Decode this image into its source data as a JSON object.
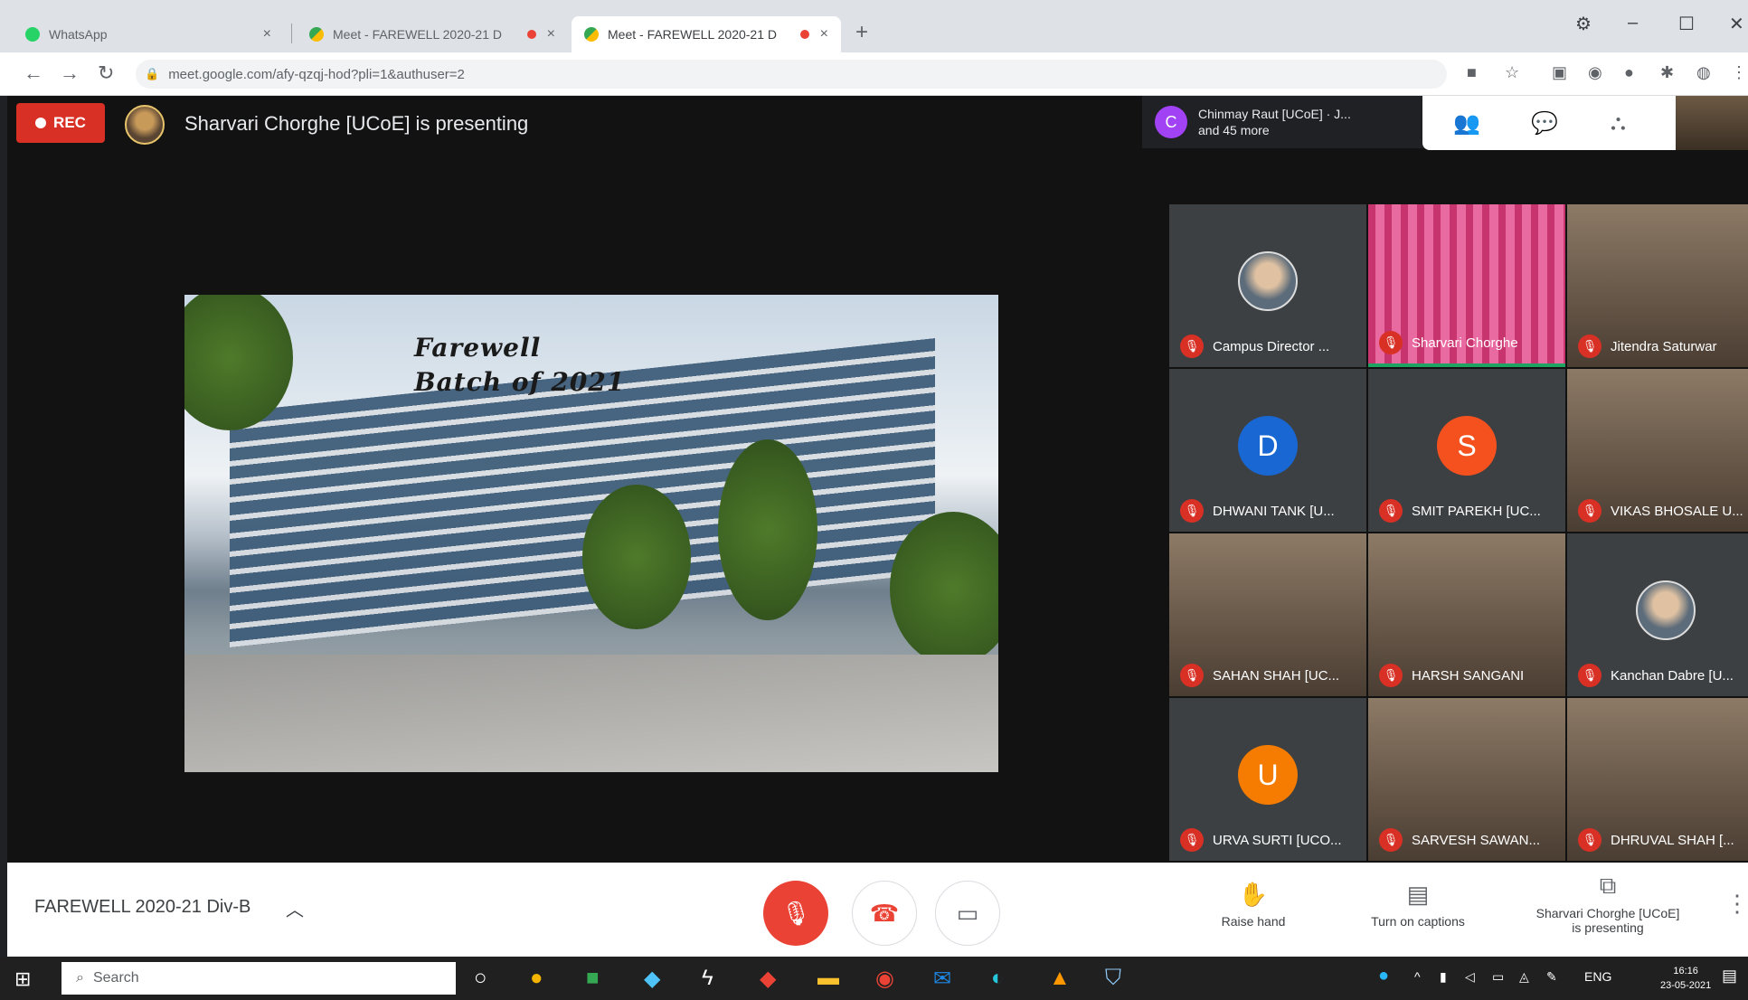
{
  "browser": {
    "tabs": [
      {
        "title": "WhatsApp",
        "color": "#25d366"
      },
      {
        "title": "Meet - FAREWELL 2020-21 D",
        "color": "#00897b"
      },
      {
        "title": "Meet - FAREWELL 2020-21 D",
        "color": "#00897b"
      }
    ],
    "close_glyph": "×",
    "new_tab_glyph": "+",
    "url": "meet.google.com/afy-qzqj-hod?pli=1&authuser=2"
  },
  "meet": {
    "rec_label": "REC",
    "presenting_text": "Sharvari Chorghe [UCoE] is presenting",
    "others": {
      "avatar_letter": "C",
      "line1": "Chinmay Raut [UCoE] · J...",
      "line2": "and 45 more"
    },
    "slide": {
      "line1": "Farewell",
      "line2": "Batch of 2021"
    },
    "participants": [
      {
        "name": "Campus Director ...",
        "type": "photo"
      },
      {
        "name": "Sharvari Chorghe",
        "type": "video-pink",
        "speaking": true
      },
      {
        "name": "Jitendra Saturwar",
        "type": "video"
      },
      {
        "name": "DHWANI TANK [U...",
        "type": "letter",
        "letter": "D",
        "color": "#1967d2"
      },
      {
        "name": "SMIT PAREKH [UC...",
        "type": "letter",
        "letter": "S",
        "color": "#f4511e"
      },
      {
        "name": "VIKAS BHOSALE U...",
        "type": "video"
      },
      {
        "name": "SAHAN SHAH [UC...",
        "type": "video"
      },
      {
        "name": "HARSH SANGANI",
        "type": "video"
      },
      {
        "name": "Kanchan Dabre [U...",
        "type": "photo"
      },
      {
        "name": "URVA SURTI [UCO...",
        "type": "letter",
        "letter": "U",
        "color": "#f57c00"
      },
      {
        "name": "SARVESH SAWAN...",
        "type": "video"
      },
      {
        "name": "DHRUVAL SHAH [...",
        "type": "video"
      }
    ]
  },
  "bottom": {
    "meeting_name": "FAREWELL 2020-21 Div-B",
    "raise_hand": "Raise hand",
    "captions": "Turn on captions",
    "presenting_line1": "Sharvari Chorghe [UCoE]",
    "presenting_line2": "is presenting"
  },
  "taskbar": {
    "search_placeholder": "Search",
    "lang": "ENG",
    "time": "16:16",
    "date": "23-05-2021"
  }
}
